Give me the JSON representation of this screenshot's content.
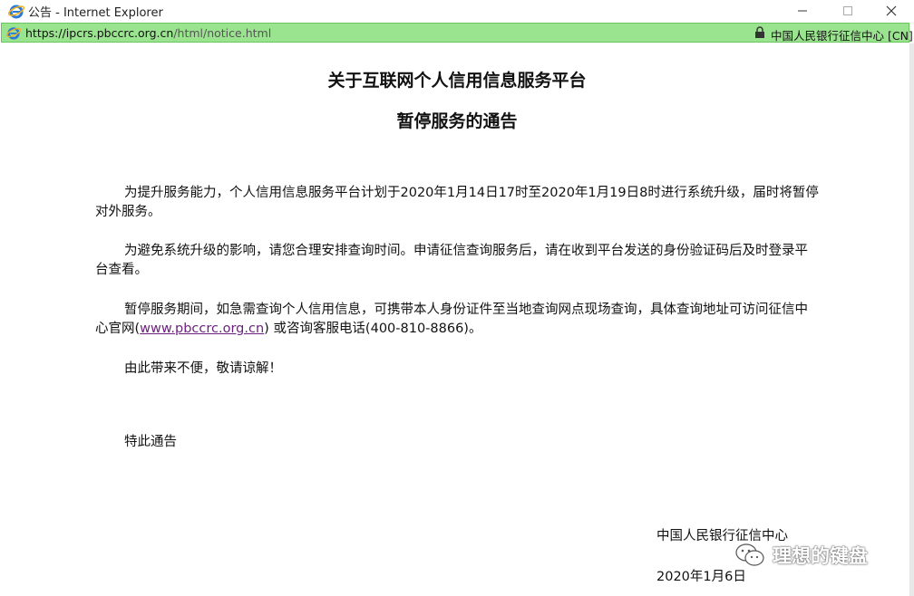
{
  "window": {
    "title": "公告 - Internet Explorer",
    "icons": {
      "app": "internet-explorer-icon",
      "minimize": "minimize-icon",
      "maximize": "maximize-icon",
      "close": "close-icon"
    }
  },
  "address_bar": {
    "url_domain": "https://ipcrs.pbccrc.org.cn",
    "url_path": "/html/notice.html",
    "certificate": "中国人民银行征信中心 [CN]",
    "secure_color": "#9be48f"
  },
  "notice": {
    "title_line1": "关于互联网个人信用信息服务平台",
    "title_line2": "暂停服务的通告",
    "p1": "为提升服务能力，个人信用信息服务平台计划于2020年1月14日17时至2020年1月19日8时进行系统升级，届时将暂停对外服务。",
    "p2": "为避免系统升级的影响，请您合理安排查询时间。申请征信查询服务后，请在收到平台发送的身份验证码后及时登录平台查看。",
    "p3_before": "暂停服务期间，如急需查询个人信用信息，可携带本人身份证件至当地查询网点现场查询，具体查询地址可访问征信中心官网(",
    "p3_link": "www.pbccrc.org.cn",
    "p3_after": ") 或咨询客服电话(400-810-8866)。",
    "p4": "由此带来不便，敬请谅解！",
    "p5": "特此通告",
    "signature": "中国人民银行征信中心",
    "date": "2020年1月6日"
  },
  "watermark": {
    "text": "理想的键盘"
  }
}
